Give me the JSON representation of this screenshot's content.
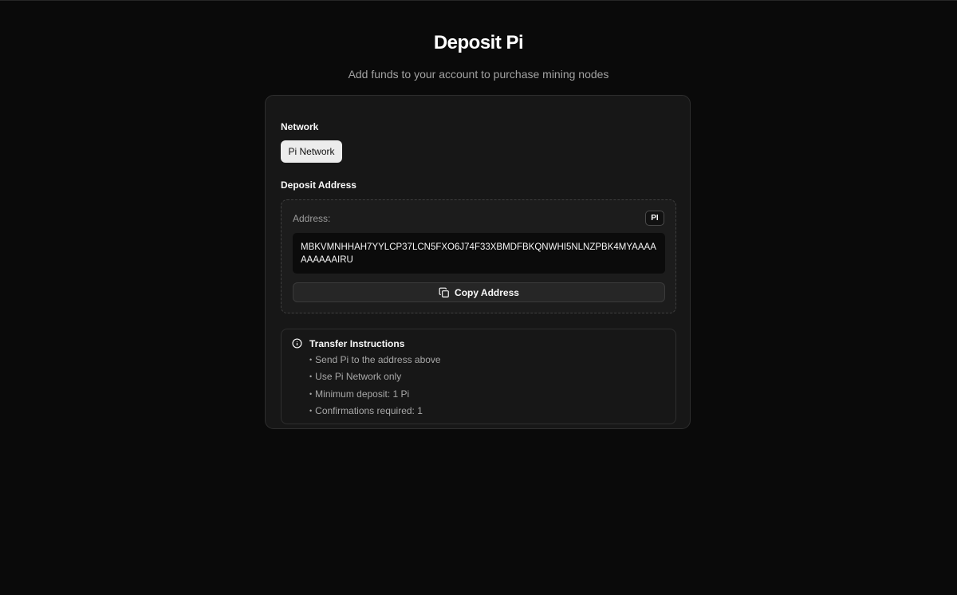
{
  "header": {
    "title": "Deposit Pi",
    "subtitle": "Add funds to your account to purchase mining nodes"
  },
  "network": {
    "label": "Network",
    "selected": "Pi Network"
  },
  "deposit": {
    "label": "Deposit Address",
    "address_caption": "Address:",
    "badge": "PI",
    "address": "MBKVMNHHAH7YYLCP37LCN5FXO6J74F33XBMDFBKQNWHI5NLNZPBK4MYAAAAAAAAAAIRU",
    "copy_label": "Copy Address"
  },
  "instructions": {
    "title": "Transfer Instructions",
    "items": [
      "Send Pi to the address above",
      "Use Pi Network only",
      "Minimum deposit: 1 Pi",
      "Confirmations required: 1"
    ]
  },
  "icons": {
    "copy": "copy-icon",
    "info": "info-icon"
  },
  "colors": {
    "background": "#0a0a0a",
    "card": "#171717",
    "selected_button": "#ececec"
  }
}
